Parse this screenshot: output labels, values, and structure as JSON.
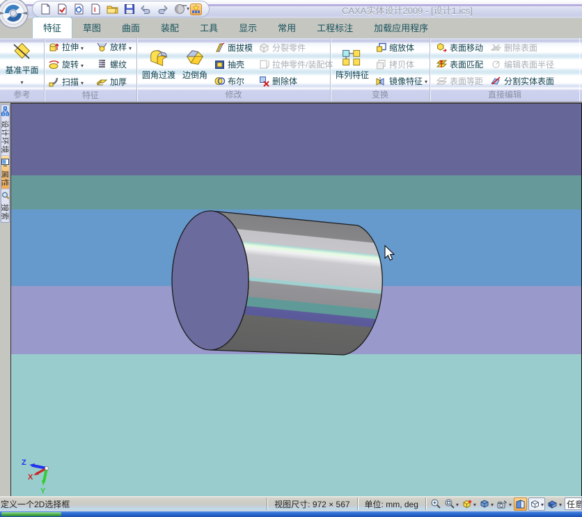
{
  "window": {
    "title": "CAXA实体设计2009 - [设计1.ics]"
  },
  "quick_access": {
    "icons": [
      "new-document",
      "check-document",
      "preview-document",
      "document-info",
      "open-folder",
      "save",
      "undo",
      "redo",
      "render-sphere",
      "design-elements",
      "more-commands"
    ]
  },
  "tabs": {
    "items": [
      "特征",
      "草图",
      "曲面",
      "装配",
      "工具",
      "显示",
      "常用",
      "工程标注",
      "加载应用程序"
    ],
    "active": "特征"
  },
  "ribbon": {
    "groups": [
      {
        "label": "参考",
        "buttons": [
          {
            "label": "基准平面",
            "dropdown": true
          }
        ]
      },
      {
        "label": "特征",
        "buttons": [
          {
            "label": "拉伸",
            "dropdown": true
          },
          {
            "label": "放样",
            "dropdown": true
          },
          {
            "label": "旋转",
            "dropdown": true
          },
          {
            "label": "螺纹",
            "dropdown": false
          },
          {
            "label": "扫描",
            "dropdown": true
          },
          {
            "label": "加厚",
            "dropdown": false
          }
        ]
      },
      {
        "label": "修改",
        "big": [
          {
            "label": "圆角过渡"
          },
          {
            "label": "边倒角"
          }
        ],
        "col1": [
          {
            "label": "面拔模"
          },
          {
            "label": "抽壳"
          },
          {
            "label": "布尔"
          }
        ],
        "col2": [
          {
            "label": "分裂零件",
            "disabled": true
          },
          {
            "label": "拉伸零件/装配体",
            "disabled": true
          },
          {
            "label": "删除体",
            "disabled": false
          }
        ]
      },
      {
        "label": "变换",
        "big": [
          {
            "label": "阵列特征"
          }
        ],
        "col1": [
          {
            "label": "缩放体"
          },
          {
            "label": "拷贝体",
            "disabled": true
          },
          {
            "label": "镜像特征",
            "dropdown": true
          }
        ]
      },
      {
        "label": "直接编辑",
        "col1": [
          {
            "label": "表面移动"
          },
          {
            "label": "表面匹配"
          },
          {
            "label": "表面等距",
            "disabled": true
          }
        ],
        "col2": [
          {
            "label": "删除表面",
            "disabled": true
          },
          {
            "label": "编辑表面半径",
            "disabled": true
          },
          {
            "label": "分割实体表面"
          }
        ]
      }
    ]
  },
  "sidebar": {
    "tabs": [
      {
        "label": "设计环境",
        "active": false
      },
      {
        "label": "属性",
        "active": true
      },
      {
        "label": "搜索",
        "active": false
      }
    ]
  },
  "canvas": {
    "bands": [
      {
        "color": "#666699",
        "from": 0,
        "to": 103
      },
      {
        "color": "#669999",
        "from": 103,
        "to": 152
      },
      {
        "color": "#6699CC",
        "from": 152,
        "to": 262
      },
      {
        "color": "#9999CC",
        "from": 262,
        "to": 360
      },
      {
        "color": "#99CCCC",
        "from": 360,
        "to": 565
      }
    ],
    "model": {
      "type": "cylinder",
      "face_color": "#6B6B9E"
    },
    "axis": {
      "x": "X",
      "y": "Y",
      "z": "Z"
    }
  },
  "statusbar": {
    "message": "定义一个2D选择框",
    "view_size": "视图尺寸: 972 × 567",
    "units": "单位: mm, deg",
    "right_text": "任意",
    "icons": [
      "zoom-in",
      "zoom-window",
      "new-scene",
      "view-cube",
      "camera-rotate",
      "shaded-view",
      "wireframe-view",
      "render-mode"
    ]
  }
}
